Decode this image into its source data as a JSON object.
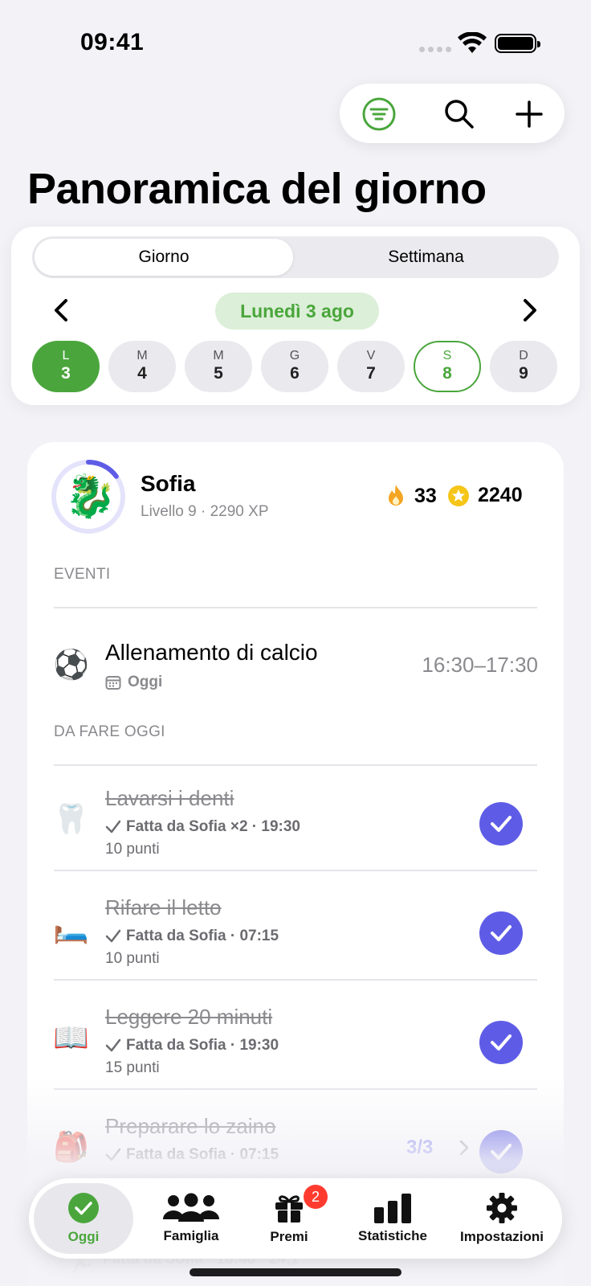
{
  "status": {
    "time": "09:41"
  },
  "toolbar": {
    "filter_icon": "filter-circle-icon",
    "search_icon": "search-icon",
    "add_icon": "plus-icon"
  },
  "page": {
    "title": "Panoramica del giorno"
  },
  "date_picker": {
    "segments": [
      "Giorno",
      "Settimana"
    ],
    "selected_segment": "Giorno",
    "current_date": "Lunedì 3 ago",
    "days": [
      {
        "letter": "L",
        "number": "3",
        "state": "selected"
      },
      {
        "letter": "M",
        "number": "4",
        "state": "normal"
      },
      {
        "letter": "M",
        "number": "5",
        "state": "normal"
      },
      {
        "letter": "G",
        "number": "6",
        "state": "normal"
      },
      {
        "letter": "V",
        "number": "7",
        "state": "normal"
      },
      {
        "letter": "S",
        "number": "8",
        "state": "today"
      },
      {
        "letter": "D",
        "number": "9",
        "state": "normal"
      }
    ]
  },
  "profile": {
    "name": "Sofia",
    "subtitle": "Livello 9 · 2290 XP",
    "avatar": "🐉",
    "level_progress": 0.15,
    "streak": "33",
    "stars": "2240"
  },
  "events": {
    "label": "EVENTI",
    "items": [
      {
        "emoji": "⚽",
        "title": "Allenamento di calcio",
        "when": "Oggi",
        "time": "16:30–17:30"
      }
    ]
  },
  "tasks": {
    "label": "DA FARE OGGI",
    "items": [
      {
        "emoji": "🦷",
        "title": "Lavarsi i denti",
        "done": "Fatta da Sofia ×2 · 19:30",
        "points": "10 punti"
      },
      {
        "emoji": "🛏️",
        "title": "Rifare il letto",
        "done": "Fatta da Sofia · 07:15",
        "points": "10 punti"
      },
      {
        "emoji": "📖",
        "title": "Leggere 20 minuti",
        "done": "Fatta da Sofia · 19:30",
        "points": "15 punti"
      },
      {
        "emoji": "🎒",
        "title": "Preparare lo zaino",
        "done": "Fatta da Sofia · 07:15",
        "points": "",
        "progress": "3/3"
      }
    ],
    "partially_hidden": {
      "emoji": "🏃",
      "done": "Fatta da Sofia · 18:48 · 24,1"
    }
  },
  "colors": {
    "accent_green": "#4aa63c",
    "accent_purple": "#5e5ce6",
    "badge_red": "#ff3b30"
  },
  "tab_bar": {
    "tabs": [
      {
        "label": "Oggi",
        "icon": "checkmark-circle-icon",
        "active": true
      },
      {
        "label": "Famiglia",
        "icon": "people-icon"
      },
      {
        "label": "Premi",
        "icon": "gift-icon",
        "badge": "2"
      },
      {
        "label": "Statistiche",
        "icon": "bar-chart-icon"
      },
      {
        "label": "Impostazioni",
        "icon": "gear-icon"
      }
    ]
  }
}
